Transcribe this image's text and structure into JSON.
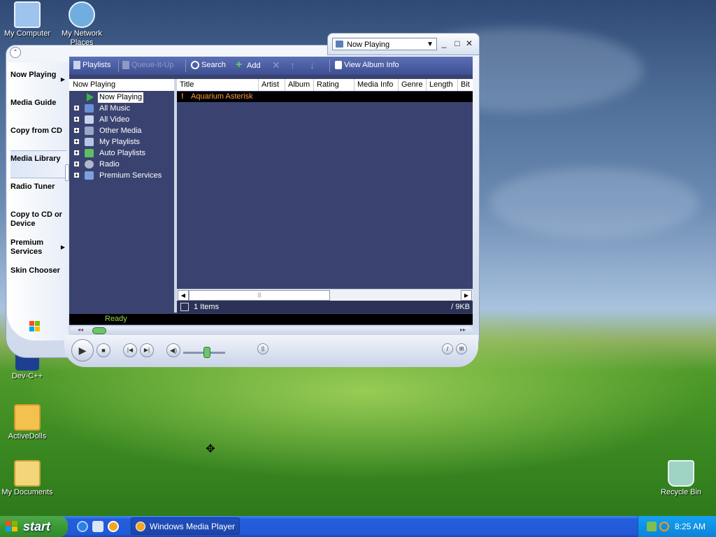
{
  "desktop": {
    "icons": [
      {
        "label": "My Computer",
        "color": "#9ec3ec"
      },
      {
        "label": "My Network Places",
        "color": "#6faede"
      },
      {
        "label": "Dev-C++",
        "color": "#1e3f8f"
      },
      {
        "label": "ActiveDolls",
        "color": "#f2c14e"
      },
      {
        "label": "My Documents",
        "color": "#f3d67a"
      },
      {
        "label": "Recycle Bin",
        "color": "#9fd3c4"
      }
    ]
  },
  "wmp": {
    "selector_value": "Now Playing",
    "win_controls": {
      "minimize": "_",
      "maximize": "□",
      "close": "✕"
    },
    "nav": [
      {
        "label": "Now Playing",
        "has_arrow": true
      },
      {
        "label": "Media Guide"
      },
      {
        "label": "Copy from CD"
      },
      {
        "label": "Media Library",
        "active": true
      },
      {
        "label": "Radio Tuner"
      },
      {
        "label": "Copy to CD or Device"
      },
      {
        "label": "Premium Services",
        "has_arrow": true
      },
      {
        "label": "Skin Chooser"
      }
    ],
    "toolbar": {
      "playlists": "Playlists",
      "queue": "Queue-It-Up",
      "search": "Search",
      "add": "Add",
      "view_album": "View Album Info"
    },
    "tree": {
      "header": "Now Playing",
      "items": [
        {
          "label": "Now Playing",
          "selected": true,
          "expandable": false,
          "icon_color": "#39b54a"
        },
        {
          "label": "All Music",
          "expandable": true,
          "icon_color": "#6b8fd6"
        },
        {
          "label": "All Video",
          "expandable": true,
          "icon_color": "#c9d3ec"
        },
        {
          "label": "Other Media",
          "expandable": true,
          "icon_color": "#9aa7c7"
        },
        {
          "label": "My Playlists",
          "expandable": true,
          "icon_color": "#b9c5e6"
        },
        {
          "label": "Auto Playlists",
          "expandable": true,
          "icon_color": "#5fbf5f"
        },
        {
          "label": "Radio",
          "expandable": true,
          "icon_color": "#b0b8cc"
        },
        {
          "label": "Premium Services",
          "expandable": true,
          "icon_color": "#7fa0de"
        }
      ]
    },
    "list": {
      "columns": [
        "Title",
        "Artist",
        "Album",
        "Rating",
        "Media Info",
        "Genre",
        "Length",
        "Bit"
      ],
      "rows": [
        {
          "title": "Aquarium Asterisk",
          "warning": "!"
        }
      ],
      "items_count": "1 Items",
      "size": "/ 9KB"
    },
    "status": "Ready"
  },
  "taskbar": {
    "start_label": "start",
    "task_label": "Windows Media Player",
    "clock": "8:25 AM"
  }
}
